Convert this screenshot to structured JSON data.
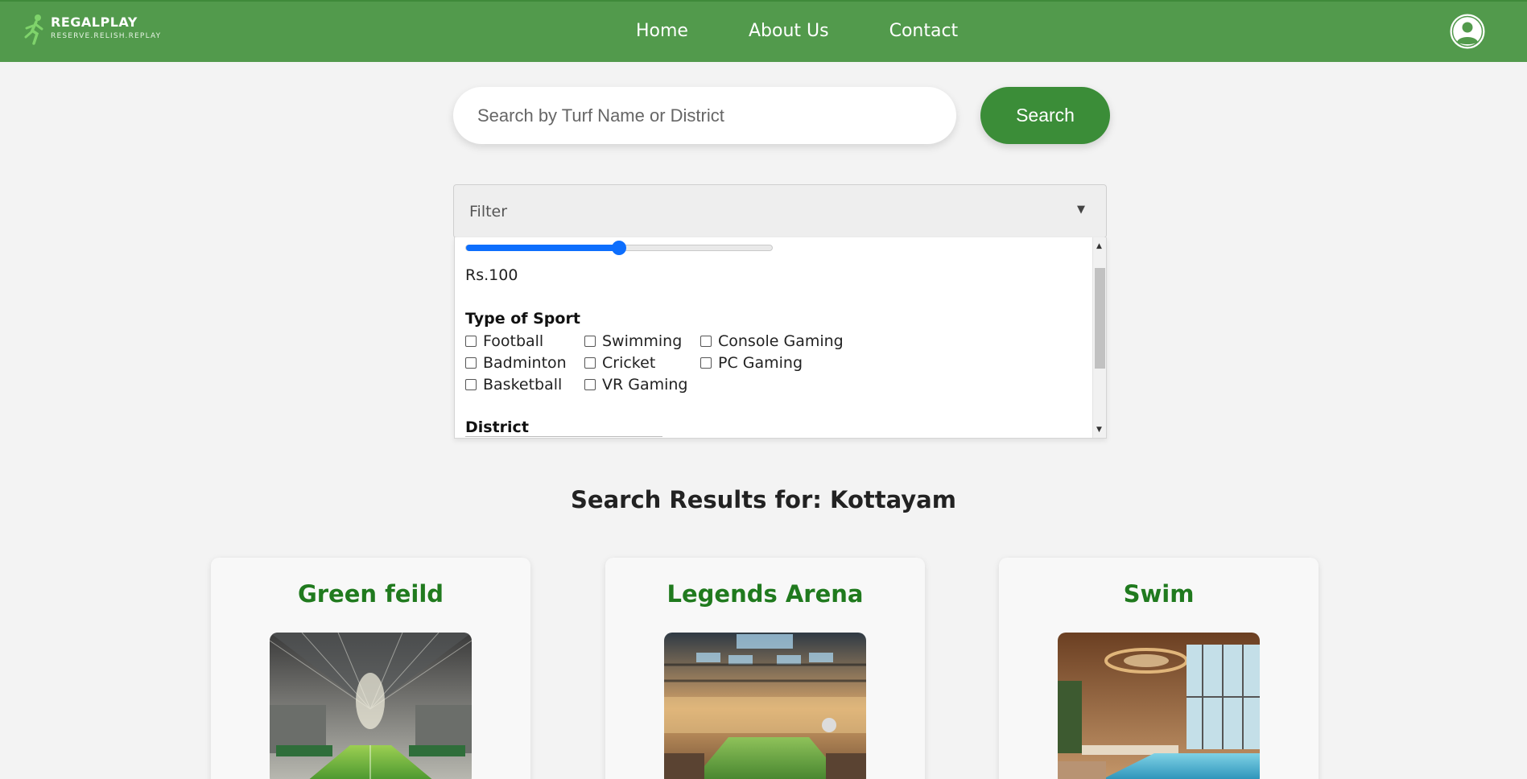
{
  "brand": {
    "name": "REGALPLAY",
    "tagline": "RESERVE.RELISH.REPLAY"
  },
  "nav": {
    "items": [
      "Home",
      "About Us",
      "Contact"
    ]
  },
  "search": {
    "placeholder": "Search by Turf Name or District",
    "button_label": "Search"
  },
  "filter": {
    "label": "Filter",
    "price": {
      "value_label": "Rs.100",
      "level_percent": 50
    },
    "sport_heading": "Type of Sport",
    "sports": [
      "Football",
      "Swimming",
      "Console Gaming",
      "Badminton",
      "Cricket",
      "PC Gaming",
      "Basketball",
      "VR Gaming"
    ],
    "district_heading": "District"
  },
  "results": {
    "heading": "Search Results for: Kottayam",
    "cards": [
      {
        "title": "Green feild"
      },
      {
        "title": "Legends Arena"
      },
      {
        "title": "Swim"
      }
    ]
  },
  "colors": {
    "navbar": "#529a4c",
    "accent": "#3b8d38",
    "card_title": "#207a1e",
    "slider": "#0d6efd"
  }
}
